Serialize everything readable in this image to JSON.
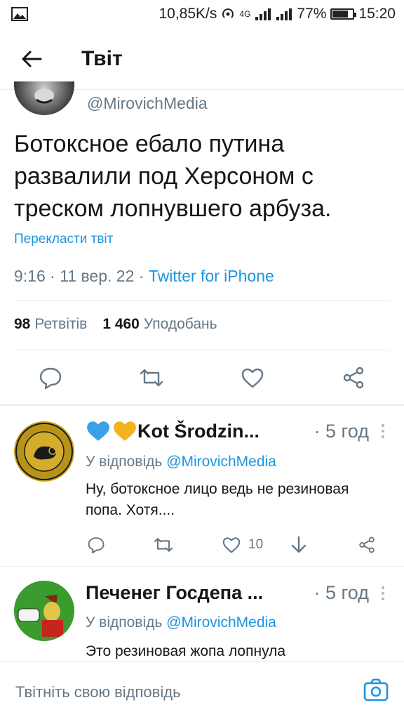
{
  "status_bar": {
    "speed": "10,85K/s",
    "network": "4G",
    "battery": "77%",
    "battery_level": 0.77,
    "time": "15:20"
  },
  "header": {
    "title": "Твіт",
    "back_icon": "arrow-left-icon"
  },
  "main_tweet": {
    "handle": "@MirovichMedia",
    "text": "Ботоксное ебало путина развалили под Херсоном с треском лопнувшего арбуза.",
    "translate_label": "Перекласти твіт",
    "time": "9:16 · 11 вер. 22 · ",
    "source": "Twitter for iPhone",
    "retweets_count": "98",
    "retweets_label": "Ретвітів",
    "likes_count": "1 460",
    "likes_label": "Уподобань"
  },
  "replies": [
    {
      "name": "Kot Šrodzin...",
      "time": "· 5 год",
      "replying_prefix": "У відповідь ",
      "mention": "@MirovichMedia",
      "text": "Ну, ботоксное лицо ведь не резиновая попа. Хотя....",
      "likes": "10",
      "heart_colors": [
        "#3aa0e8",
        "#f2b31e"
      ]
    },
    {
      "name": "Печенег Госдепа ...",
      "time": "· 5 год",
      "replying_prefix": "У відповідь ",
      "mention": "@MirovichMedia",
      "text": "Это резиновая жопа лопнула"
    }
  ],
  "compose": {
    "placeholder": "Твітніть свою відповідь"
  },
  "colors": {
    "accent": "#1b95e0",
    "secondary_text": "#657786",
    "divider": "#e6ecf0"
  }
}
